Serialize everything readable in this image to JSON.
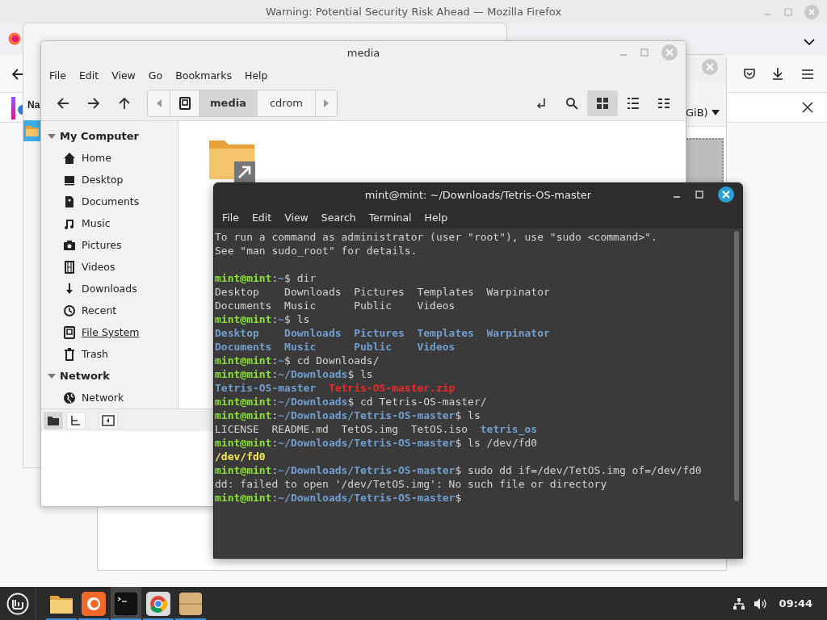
{
  "firefox": {
    "title": "Warning: Potential Security Risk Ahead — Mozilla Firefox"
  },
  "archive_window": {
    "header_text": "Na"
  },
  "back_window": {
    "dropdown": "GiB)"
  },
  "file_manager": {
    "title": "media",
    "menu": [
      "File",
      "Edit",
      "View",
      "Go",
      "Bookmarks",
      "Help"
    ],
    "path": [
      {
        "label": "media",
        "selected": true
      },
      {
        "label": "cdrom",
        "selected": false
      }
    ],
    "views": [
      {
        "kind": "icon",
        "selected": true
      },
      {
        "kind": "list",
        "selected": false
      },
      {
        "kind": "compact",
        "selected": false
      }
    ],
    "sidebar": [
      {
        "label": "My Computer",
        "expanded": true,
        "children": [
          {
            "label": "Home",
            "kind": "home",
            "selected": false
          },
          {
            "label": "Desktop",
            "kind": "desktop",
            "selected": false
          },
          {
            "label": "Documents",
            "kind": "document",
            "selected": false
          },
          {
            "label": "Music",
            "kind": "music",
            "selected": false
          },
          {
            "label": "Pictures",
            "kind": "camera",
            "selected": false
          },
          {
            "label": "Videos",
            "kind": "film",
            "selected": false
          },
          {
            "label": "Downloads",
            "kind": "download",
            "selected": false
          },
          {
            "label": "Recent",
            "kind": "recent",
            "selected": false
          },
          {
            "label": "File System",
            "kind": "drive",
            "selected": true
          },
          {
            "label": "Trash",
            "kind": "trash",
            "selected": false
          }
        ]
      },
      {
        "label": "Network",
        "expanded": true,
        "children": [
          {
            "label": "Network",
            "kind": "globe",
            "selected": false
          }
        ]
      }
    ],
    "bottom_buttons": [
      {
        "kind": "places",
        "selected": true
      },
      {
        "kind": "tree",
        "selected": false
      },
      {
        "kind": "sidebar",
        "selected": false
      }
    ]
  },
  "terminal": {
    "title": "mint@mint: ~/Downloads/Tetris-OS-master",
    "menu": [
      "File",
      "Edit",
      "View",
      "Search",
      "Terminal",
      "Help"
    ],
    "lines": [
      {
        "kind": "text",
        "segments": [
          {
            "kind": "plain",
            "text": "To run a command as administrator (user \"root\"), use \"sudo <command>\"."
          }
        ]
      },
      {
        "kind": "text",
        "segments": [
          {
            "kind": "plain",
            "text": "See \"man sudo_root\" for details."
          }
        ]
      },
      {
        "kind": "blank"
      },
      {
        "kind": "text",
        "segments": [
          {
            "kind": "user",
            "text": "mint@mint"
          },
          {
            "kind": "plain",
            "text": ":"
          },
          {
            "kind": "path",
            "text": "~"
          },
          {
            "kind": "plain",
            "text": "$ dir"
          }
        ]
      },
      {
        "kind": "text",
        "segments": [
          {
            "kind": "plain",
            "text": "Desktop    Downloads  Pictures  Templates  Warpinator"
          }
        ]
      },
      {
        "kind": "text",
        "segments": [
          {
            "kind": "plain",
            "text": "Documents  Music      Public    Videos"
          }
        ]
      },
      {
        "kind": "text",
        "segments": [
          {
            "kind": "user",
            "text": "mint@mint"
          },
          {
            "kind": "plain",
            "text": ":"
          },
          {
            "kind": "path",
            "text": "~"
          },
          {
            "kind": "plain",
            "text": "$ ls"
          }
        ]
      },
      {
        "kind": "text",
        "segments": [
          {
            "kind": "dir",
            "text": "Desktop    Downloads  Pictures  Templates  Warpinator"
          }
        ]
      },
      {
        "kind": "text",
        "segments": [
          {
            "kind": "dir",
            "text": "Documents  Music      Public    Videos"
          }
        ]
      },
      {
        "kind": "text",
        "segments": [
          {
            "kind": "user",
            "text": "mint@mint"
          },
          {
            "kind": "plain",
            "text": ":"
          },
          {
            "kind": "path",
            "text": "~"
          },
          {
            "kind": "plain",
            "text": "$ cd Downloads/"
          }
        ]
      },
      {
        "kind": "text",
        "segments": [
          {
            "kind": "user",
            "text": "mint@mint"
          },
          {
            "kind": "plain",
            "text": ":"
          },
          {
            "kind": "path",
            "text": "~/Downloads"
          },
          {
            "kind": "plain",
            "text": "$ ls"
          }
        ]
      },
      {
        "kind": "text",
        "segments": [
          {
            "kind": "dir",
            "text": "Tetris-OS-master  "
          },
          {
            "kind": "archive",
            "text": "Tetris-OS-master.zip"
          }
        ]
      },
      {
        "kind": "text",
        "segments": [
          {
            "kind": "user",
            "text": "mint@mint"
          },
          {
            "kind": "plain",
            "text": ":"
          },
          {
            "kind": "path",
            "text": "~/Downloads"
          },
          {
            "kind": "plain",
            "text": "$ cd Tetris-OS-master/"
          }
        ]
      },
      {
        "kind": "text",
        "segments": [
          {
            "kind": "user",
            "text": "mint@mint"
          },
          {
            "kind": "plain",
            "text": ":"
          },
          {
            "kind": "path",
            "text": "~/Downloads/Tetris-OS-master"
          },
          {
            "kind": "plain",
            "text": "$ ls"
          }
        ]
      },
      {
        "kind": "text",
        "segments": [
          {
            "kind": "plain",
            "text": "LICENSE  README.md  TetOS.img  TetOS.iso  "
          },
          {
            "kind": "dir",
            "text": "tetris_os"
          }
        ]
      },
      {
        "kind": "text",
        "segments": [
          {
            "kind": "user",
            "text": "mint@mint"
          },
          {
            "kind": "plain",
            "text": ":"
          },
          {
            "kind": "path",
            "text": "~/Downloads/Tetris-OS-master"
          },
          {
            "kind": "plain",
            "text": "$ ls /dev/fd0"
          }
        ]
      },
      {
        "kind": "text",
        "segments": [
          {
            "kind": "device",
            "text": "/dev/fd0"
          }
        ]
      },
      {
        "kind": "text",
        "segments": [
          {
            "kind": "user",
            "text": "mint@mint"
          },
          {
            "kind": "plain",
            "text": ":"
          },
          {
            "kind": "path",
            "text": "~/Downloads/Tetris-OS-master"
          },
          {
            "kind": "plain",
            "text": "$ sudo dd if=/dev/TetOS.img of=/dev/fd0"
          }
        ]
      },
      {
        "kind": "text",
        "segments": [
          {
            "kind": "plain",
            "text": "dd: failed to open '/dev/TetOS.img': No such file or directory"
          }
        ]
      },
      {
        "kind": "text",
        "segments": [
          {
            "kind": "user",
            "text": "mint@mint"
          },
          {
            "kind": "plain",
            "text": ":"
          },
          {
            "kind": "path",
            "text": "~/Downloads/Tetris-OS-master"
          },
          {
            "kind": "plain",
            "text": "$"
          }
        ]
      }
    ]
  },
  "taskbar": {
    "apps": [
      {
        "kind": "files",
        "running": true,
        "selected": false
      },
      {
        "kind": "browser",
        "running": true,
        "selected": false
      },
      {
        "kind": "terminal",
        "running": true,
        "selected": true
      },
      {
        "kind": "chrome",
        "running": true,
        "selected": false
      },
      {
        "kind": "archive",
        "running": true,
        "selected": false
      }
    ],
    "clock": "09:44"
  }
}
